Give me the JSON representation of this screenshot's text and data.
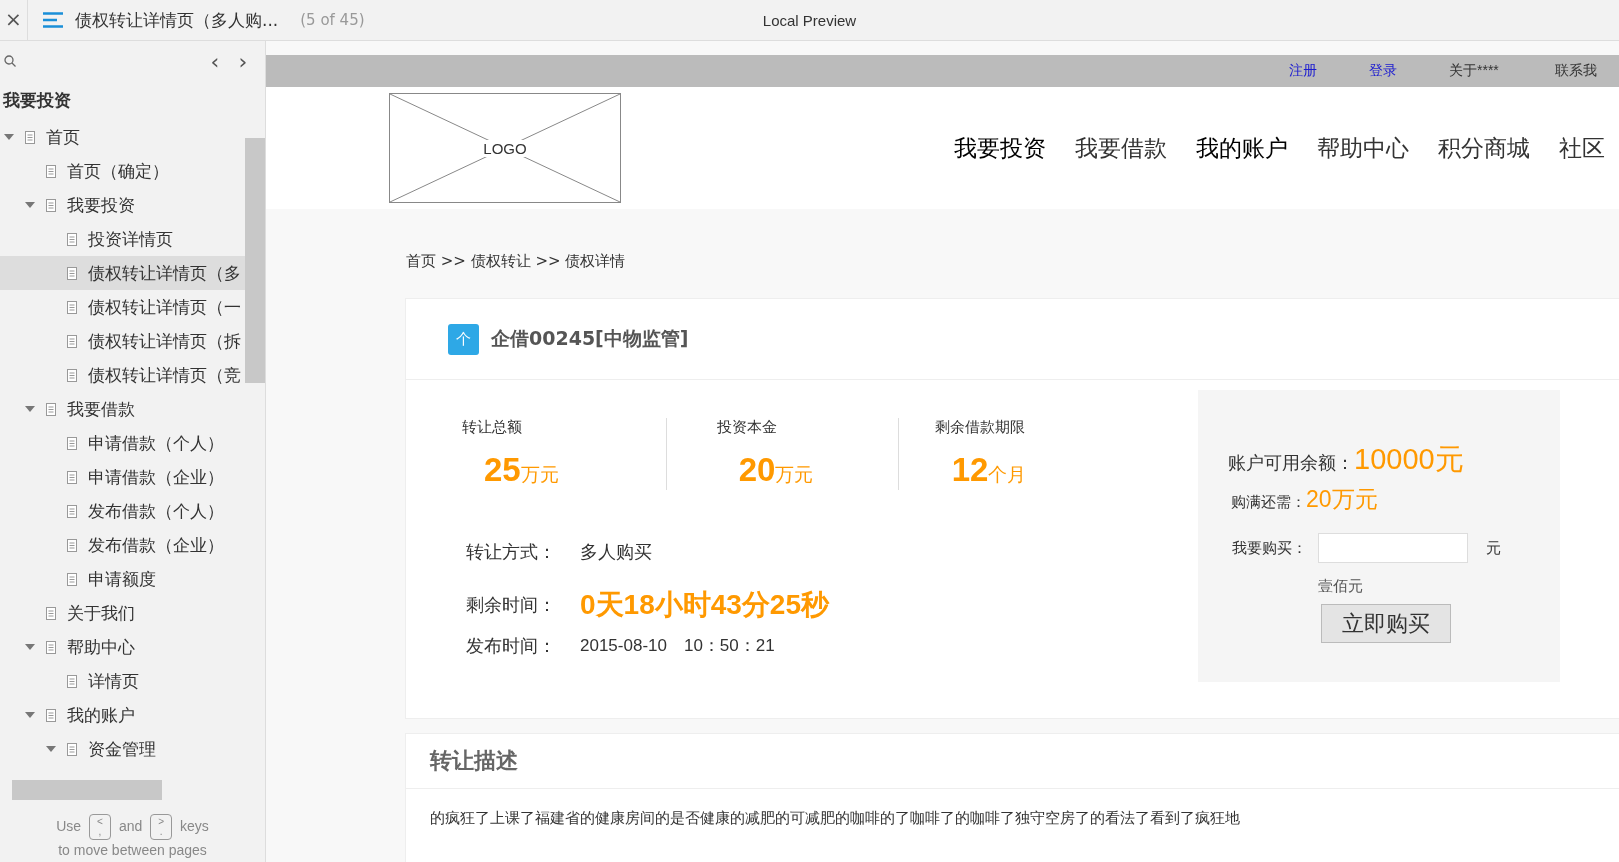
{
  "toolbar": {
    "close": "×",
    "title": "债权转让详情页（多人购...",
    "count": "(5 of 45)",
    "preview": "Local Preview"
  },
  "sidebar": {
    "nav_prev": "‹",
    "nav_next": "›",
    "heading": "我要投资",
    "tree": [
      {
        "label": "首页",
        "expanded": true,
        "selected": false,
        "children": [
          {
            "label": "首页（确定）",
            "selected": false
          },
          {
            "label": "我要投资",
            "expanded": true,
            "selected": false,
            "children": [
              {
                "label": "投资详情页",
                "selected": false
              },
              {
                "label": "债权转让详情页（多",
                "selected": true
              },
              {
                "label": "债权转让详情页（一",
                "selected": false
              },
              {
                "label": "债权转让详情页（拆",
                "selected": false
              },
              {
                "label": "债权转让详情页（竞",
                "selected": false
              }
            ]
          },
          {
            "label": "我要借款",
            "expanded": true,
            "selected": false,
            "children": [
              {
                "label": "申请借款（个人）",
                "selected": false
              },
              {
                "label": "申请借款（企业）",
                "selected": false
              },
              {
                "label": "发布借款（个人）",
                "selected": false
              },
              {
                "label": "发布借款（企业）",
                "selected": false
              },
              {
                "label": "申请额度",
                "selected": false
              }
            ]
          },
          {
            "label": "关于我们",
            "selected": false
          },
          {
            "label": "帮助中心",
            "expanded": true,
            "selected": false,
            "children": [
              {
                "label": "详情页",
                "selected": false
              }
            ]
          },
          {
            "label": "我的账户",
            "expanded": true,
            "selected": false,
            "children": [
              {
                "label": "资金管理",
                "expanded": true,
                "selected": false
              }
            ]
          }
        ]
      }
    ],
    "hint": {
      "before": "Use",
      "key1": [
        "<",
        ","
      ],
      "mid": "and",
      "key2": [
        ">",
        "."
      ],
      "after": "keys",
      "line2": "to move between pages"
    }
  },
  "page": {
    "top_links": [
      {
        "label": "注册",
        "kind": "link"
      },
      {
        "label": "登录",
        "kind": "link"
      },
      {
        "label": "关于****",
        "kind": "text"
      },
      {
        "label": "联系我",
        "kind": "text"
      }
    ],
    "logo": "LOGO",
    "nav": [
      {
        "label": "我要投资",
        "selected": true
      },
      {
        "label": "我要借款",
        "selected": false
      },
      {
        "label": "我的账户",
        "selected": true
      },
      {
        "label": "帮助中心",
        "selected": false
      },
      {
        "label": "积分商城",
        "selected": false
      },
      {
        "label": "社区",
        "selected": false
      }
    ],
    "breadcrumb": "首页 >> 债权转让 >> 债权详情",
    "loan": {
      "badge": "个",
      "title": "企借00245[中物监管]",
      "stats": [
        {
          "label": "转让总额",
          "value": "25",
          "unit": "万元"
        },
        {
          "label": "投资本金",
          "value": "20",
          "unit": "万元"
        },
        {
          "label": "剩余借款期限",
          "value": "12",
          "unit": "个月"
        }
      ],
      "method_label": "转让方式：",
      "method": "多人购买",
      "remaining_label": "剩余时间：",
      "remaining": "0天18小时43分25秒",
      "published_label": "发布时间：",
      "published": "2015-08-10　10：50：21",
      "balance_label": "账户可用余额：",
      "balance": "10000元",
      "needed_label": "购满还需：",
      "needed": "20万元",
      "buy_label": "我要购买：",
      "buy_unit": "元",
      "buy_hint": "壹佰元",
      "buy_button": "立即购买"
    },
    "description": {
      "title": "转让描述",
      "text": "的疯狂了上课了福建省的健康房间的是否健康的减肥的可减肥的咖啡的了咖啡了的咖啡了独守空房了的看法了看到了疯狂地"
    }
  }
}
